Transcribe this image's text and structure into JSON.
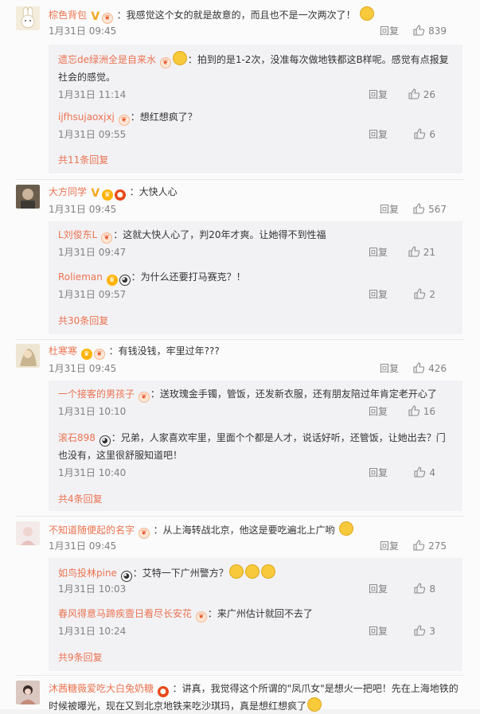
{
  "labels": {
    "reply": "回复"
  },
  "comments": [
    {
      "user": "棕色背包",
      "badges": [
        "v",
        "vip"
      ],
      "text": "：我感觉这个女的就是故意的，而且也不是一次两次了！",
      "time": "1月31日 09:45",
      "likes": "839",
      "replies": [
        {
          "user": "遗忘de绿洲全是自来水",
          "text": "：拍到的是1-2次，没准每次做地铁都这B样呢。感觉有点报复社会的感觉。",
          "time": "1月31日 11:14",
          "likes": "26"
        },
        {
          "user": "ijfhsujaoxjxj",
          "text": "：想红想疯了？",
          "time": "1月31日 09:55",
          "likes": "6"
        }
      ],
      "more": "共11条回复"
    },
    {
      "user": "大方同学",
      "badges": [
        "v",
        "crown",
        "red"
      ],
      "text": "：大快人心",
      "time": "1月31日 09:45",
      "likes": "567",
      "replies": [
        {
          "user": "L刘俊东L",
          "text": "：这就大快人心了，判20年才爽。让她得不到性福",
          "time": "1月31日 09:47",
          "likes": "21"
        },
        {
          "user": "Rolieman",
          "text": "：为什么还要打马赛克？！",
          "time": "1月31日 09:57",
          "likes": "2"
        }
      ],
      "more": "共30条回复"
    },
    {
      "user": "杜寒寒",
      "badges": [
        "crown",
        "vip"
      ],
      "text": "：有钱没钱，牢里过年???",
      "time": "1月31日 09:45",
      "likes": "426",
      "replies": [
        {
          "user": "一个接客的男孩子",
          "text": "：送玫瑰金手镯，管饭，还发新衣服，还有朋友陪过年肯定老开心了",
          "time": "1月31日 10:10",
          "likes": "16"
        },
        {
          "user": "滚石898",
          "text": "：兄弟，人家喜欢牢里，里面个个都是人才，说话好听，还管饭，让她出去？门也没有，这里很舒服知道吧！",
          "time": "1月31日 10:40",
          "likes": "4"
        }
      ],
      "more": "共4条回复"
    },
    {
      "user": "不知道随便起的名字",
      "badges": [
        "vip"
      ],
      "text": "：从上海转战北京，他这是要吃遍北上广哟",
      "time": "1月31日 09:45",
      "likes": "275",
      "replies": [
        {
          "user": "如鸟投林pine",
          "text": "：艾特一下广州警方？",
          "time": "1月31日 10:03",
          "likes": "8"
        },
        {
          "user": "春风得意马蹄疾壹日看尽长安花",
          "text": "：来广州估计就回不去了",
          "time": "1月31日 10:24",
          "likes": "3"
        }
      ],
      "more": "共9条回复"
    },
    {
      "user": "沐茜糖薇爱吃大白兔奶糖",
      "badges": [
        "red"
      ],
      "text": "：讲真，我觉得这个所谓的\"凤爪女\"是想火一把吧！先在上海地铁的时候被曝光，现在又到北京地铁来吃沙琪玛，真是想红想疯了",
      "time": "",
      "likes": ""
    }
  ]
}
